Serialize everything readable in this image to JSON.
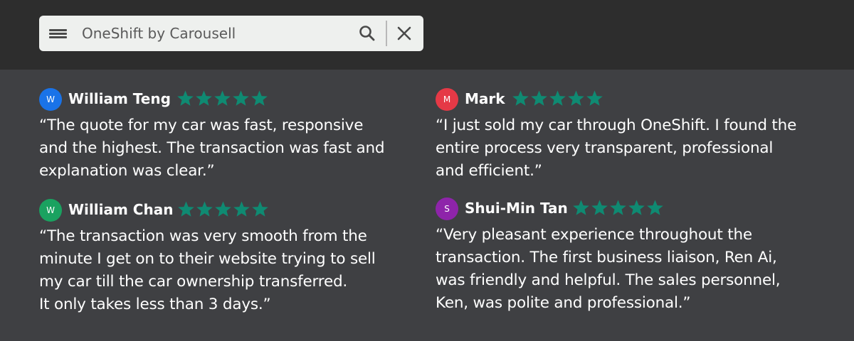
{
  "search": {
    "value": "OneShift by Carousell",
    "menu_icon": "hamburger-menu-icon",
    "search_icon": "search-icon",
    "close_icon": "close-icon"
  },
  "colors": {
    "star": "#0f8a72",
    "avatar_blue": "#1a73e8",
    "avatar_red": "#e53946",
    "avatar_green": "#1aa260",
    "avatar_purple": "#8e24aa"
  },
  "reviews": [
    {
      "initial": "W",
      "name": "William Teng",
      "rating": 5,
      "quote": "“The quote for my car was fast, responsive\nand the highest. The transaction was fast and\nexplanation was clear.”"
    },
    {
      "initial": "M",
      "name": "Mark",
      "rating": 5,
      "quote": "“I just sold my car through OneShift. I found the\nentire process very transparent, professional\nand efficient.”"
    },
    {
      "initial": "W",
      "name": "William Chan",
      "rating": 5,
      "quote": "“The transaction was very smooth from the\nminute I get on to their website trying to sell\nmy car till the car ownership transferred.\nIt only takes less than 3 days.”"
    },
    {
      "initial": "S",
      "name": "Shui-Min Tan",
      "rating": 5,
      "quote": "“Very pleasant experience throughout the\ntransaction. The first business liaison, Ren Ai,\nwas friendly and helpful. The sales personnel,\nKen, was polite and professional.”"
    }
  ]
}
